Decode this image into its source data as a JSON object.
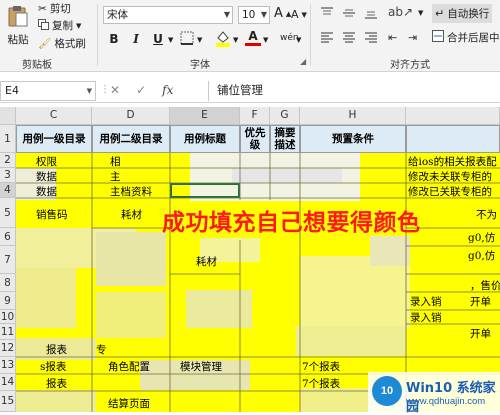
{
  "ribbon": {
    "paste_label": "粘贴",
    "cut_label": "剪切",
    "copy_label": "复制",
    "format_painter_label": "格式刷",
    "clipboard_group": "剪贴板",
    "font_name": "宋体",
    "font_size": "10",
    "grow_font": "A",
    "shrink_font": "A",
    "bold": "B",
    "italic": "I",
    "underline": "U",
    "font_color_glyph": "A",
    "phonetic": "wén",
    "font_group": "字体",
    "wrap_text_label": "自动换行",
    "merge_label": "合并后居中",
    "align_group": "对齐方式"
  },
  "formula_bar": {
    "name_box": "E4",
    "cancel_glyph": "✕",
    "enter_glyph": "✓",
    "fx_glyph": "fx",
    "content": "铺位管理"
  },
  "columns": [
    "C",
    "D",
    "E",
    "F",
    "G",
    "H"
  ],
  "rows": [
    "1",
    "2",
    "3",
    "4",
    "5",
    "6",
    "7",
    "8",
    "9",
    "10",
    "11",
    "12",
    "13",
    "14",
    "15"
  ],
  "headers": {
    "c": "用例一级目录",
    "d": "用例二级目录",
    "e": "用例标题",
    "f": "优先级",
    "g": "摘要描述",
    "h": "预置条件"
  },
  "cells": {
    "c2": "权限",
    "d2": "相",
    "c3": "数据",
    "d3": "主",
    "c4": "数据",
    "d4": "主档资料",
    "c5": "销售码",
    "d5": "耗材",
    "e7": "耗材",
    "c12": "报表",
    "d12": "专",
    "c13": "s报表",
    "d13": "角色配置",
    "e13": "模块管理",
    "h13": "7个报表",
    "h14": "7个报表",
    "c14": "报表",
    "d15": "结算页面",
    "i2": "给ios的相关报表配",
    "i3": "修改未关联专柜的",
    "i4": "修改已关联专柜的",
    "i5": "不为",
    "i6a": "g0,仿",
    "i6b": "g0,仿",
    "i9": "，售价",
    "i10a": "录入销",
    "i10b": "开单",
    "i11": "录入销",
    "i12": "开单"
  },
  "annotation": "成功填充自己想要得颜色",
  "watermark": {
    "logo": "10",
    "title": "Win10 系统家园",
    "url": "www.qdhuajin.com"
  },
  "colors": {
    "fill_yellow": "#ffff00",
    "header_blue": "#ddebf7",
    "annotation_red": "#ff1a1a",
    "watermark_blue": "#1a5fb4"
  }
}
